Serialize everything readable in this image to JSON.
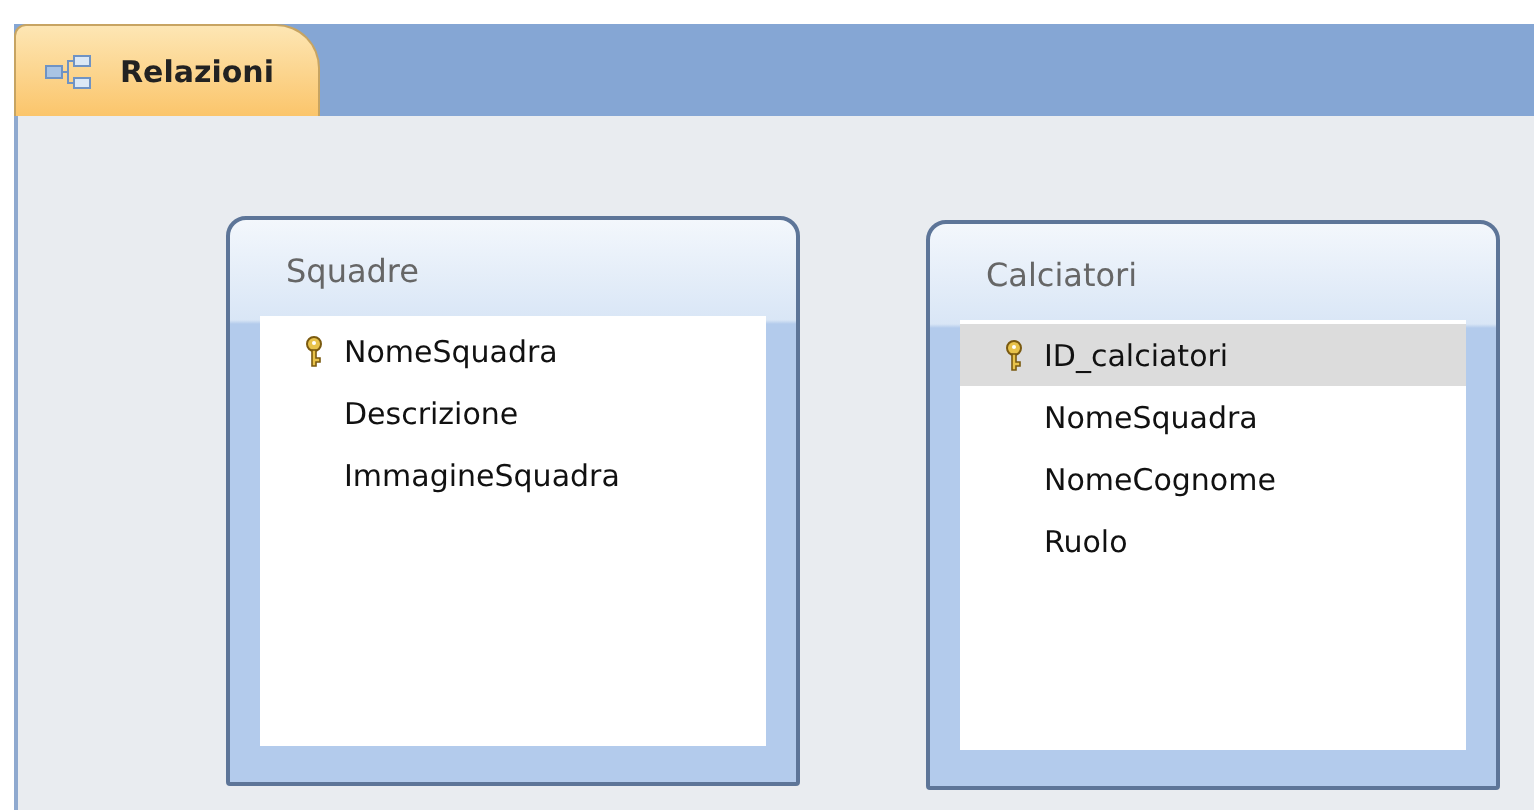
{
  "tabs": [
    {
      "label": "Relazioni",
      "selected": true
    }
  ],
  "tables": [
    {
      "title": "Squadre",
      "fields": [
        {
          "name": "NomeSquadra",
          "key": true,
          "selected": false
        },
        {
          "name": "Descrizione",
          "key": false,
          "selected": false
        },
        {
          "name": "ImmagineSquadra",
          "key": false,
          "selected": false
        }
      ]
    },
    {
      "title": "Calciatori",
      "fields": [
        {
          "name": "ID_calciatori",
          "key": true,
          "selected": true
        },
        {
          "name": "NomeSquadra",
          "key": false,
          "selected": false
        },
        {
          "name": "NomeCognome",
          "key": false,
          "selected": false
        },
        {
          "name": "Ruolo",
          "key": false,
          "selected": false
        }
      ]
    }
  ]
}
